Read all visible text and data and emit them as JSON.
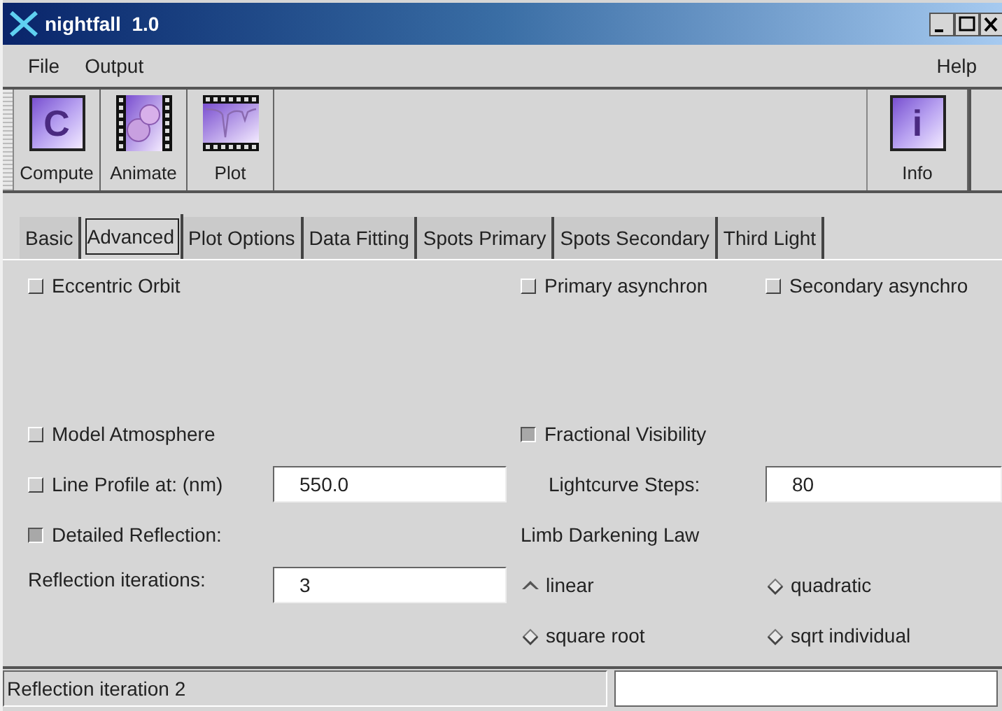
{
  "window": {
    "title": "nightfall  1.0"
  },
  "menu": {
    "left": [
      "File",
      "Output"
    ],
    "right": [
      "Help"
    ]
  },
  "toolbar": {
    "left": [
      {
        "label": "Compute",
        "kind": "letter",
        "glyph": "C"
      },
      {
        "label": "Animate",
        "kind": "film"
      },
      {
        "label": "Plot",
        "kind": "plot"
      }
    ],
    "right": [
      {
        "label": "Info",
        "kind": "letter",
        "glyph": "i"
      }
    ]
  },
  "tabs": [
    {
      "label": "Basic",
      "selected": false
    },
    {
      "label": "Advanced",
      "selected": true
    },
    {
      "label": "Plot Options",
      "selected": false
    },
    {
      "label": "Data Fitting",
      "selected": false
    },
    {
      "label": "Spots Primary",
      "selected": false
    },
    {
      "label": "Spots Secondary",
      "selected": false
    },
    {
      "label": "Third Light",
      "selected": false
    }
  ],
  "rows": [
    {
      "left": [
        {
          "kind": "checkbox",
          "label": "Eccentric Orbit",
          "checked": false
        }
      ],
      "right": [
        {
          "kind": "checkbox",
          "label": "Primary asynchron",
          "checked": false
        },
        {
          "kind": "checkbox",
          "label": "Secondary asynchro",
          "checked": false
        }
      ]
    },
    {
      "left": [
        {
          "kind": "checkbox",
          "label": "Model Atmosphere",
          "checked": false
        }
      ],
      "right": [
        {
          "kind": "checkbox",
          "label": "Fractional Visibility",
          "checked": true
        }
      ]
    },
    {
      "left": [
        {
          "kind": "field",
          "label": "Line Profile at: (nm)",
          "checked": false,
          "value": "550.0"
        }
      ],
      "right": [
        {
          "kind": "field",
          "label": "Lightcurve Steps:",
          "value": "80"
        }
      ]
    },
    {
      "left": [
        {
          "kind": "checkbox",
          "label": "Detailed Reflection:",
          "checked": true
        }
      ],
      "right": [
        {
          "kind": "heading",
          "label": "Limb Darkening Law"
        }
      ]
    },
    {
      "left": [
        {
          "kind": "field",
          "label": "Reflection iterations:",
          "value": "3"
        }
      ],
      "right": [
        {
          "kind": "radio",
          "label": "linear",
          "selected": true
        },
        {
          "kind": "radio",
          "label": "quadratic",
          "selected": false
        }
      ]
    },
    {
      "left": [],
      "right": [
        {
          "kind": "radio",
          "label": "square root",
          "selected": false
        },
        {
          "kind": "radio",
          "label": "sqrt individual",
          "selected": false
        }
      ]
    }
  ],
  "status_bar": {
    "message": "Reflection iteration 2"
  }
}
